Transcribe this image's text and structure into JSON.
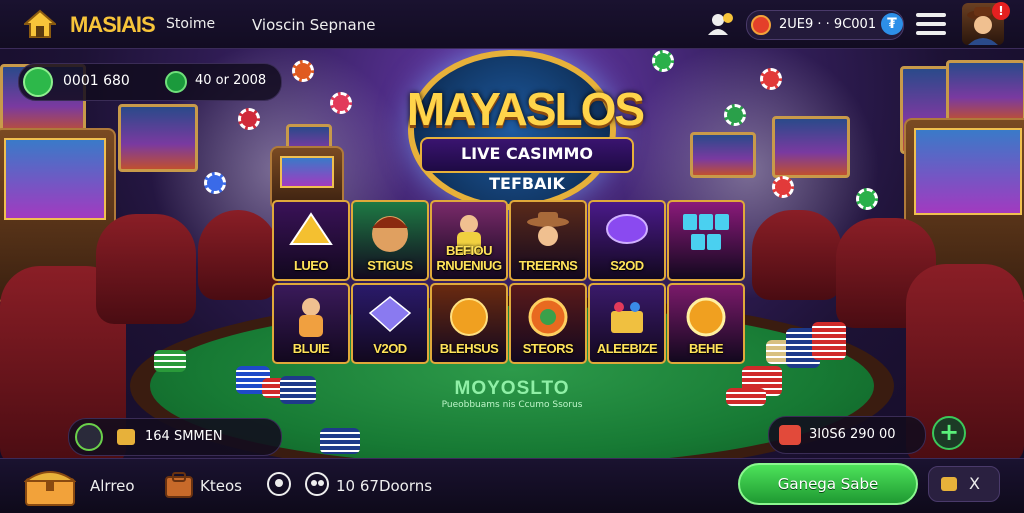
{
  "header": {
    "brand": "MASIAIS",
    "brand_sub": "Stoime",
    "menu_text": "Vioscin Sepnane",
    "currency_value": "2UE9 · · 9C001",
    "currency_plus": "₮",
    "alert_badge": "!"
  },
  "stats": {
    "gems": "0001 680",
    "coins": "40 or 2008"
  },
  "logo": {
    "title": "MAYASLOS",
    "subtitle": "LIVE CASIMMO TEFBAIK"
  },
  "games": [
    {
      "label": "LUEO",
      "bg": "#3a1258",
      "art": "triangle",
      "art_color": "#f4c030"
    },
    {
      "label": "STIGUS",
      "bg": "#1e7a44",
      "art": "face",
      "art_color": "#e0a060"
    },
    {
      "label": "BEFIOU RNUENIUG",
      "bg": "#7a2a6a",
      "art": "character",
      "art_color": "#f0d040"
    },
    {
      "label": "TREERNS",
      "bg": "#5a2a1a",
      "art": "cowboy",
      "art_color": "#a86a3a"
    },
    {
      "label": "S2OD",
      "bg": "#4a1a8a",
      "art": "gem",
      "art_color": "#8a4af0"
    },
    {
      "label": "",
      "bg": "#8a1a7a",
      "art": "cubes",
      "art_color": "#4ad0f0"
    },
    {
      "label": "BLUIE",
      "bg": "#3a1a5a",
      "art": "character",
      "art_color": "#f0a040"
    },
    {
      "label": "V2OD",
      "bg": "#2a1a6a",
      "art": "crystal",
      "art_color": "#8a7af0"
    },
    {
      "label": "BLEHSUS",
      "bg": "#6a2a10",
      "art": "orb",
      "art_color": "#f0a020"
    },
    {
      "label": "STEORS",
      "bg": "#5a1a1a",
      "art": "coin",
      "art_color": "#e86a20"
    },
    {
      "label": "ALEEBIZE",
      "bg": "#3a1a6a",
      "art": "cake",
      "art_color": "#f0c040"
    },
    {
      "label": "BEHE",
      "bg": "#7a1a6a",
      "art": "medal",
      "art_color": "#f0a020"
    }
  ],
  "table": {
    "title": "MOYOSLTO",
    "subtitle": "Pueobbuams nis Ccumo Ssorus"
  },
  "bottom_left_pill": {
    "text": "164 SMMEN"
  },
  "bottom_right_pill": {
    "text": "3I0S6 290 00",
    "add": "+"
  },
  "bottombar": {
    "nav_1": "Alrreo",
    "nav_2": "Kteos",
    "nav_3": "10 67Doorns",
    "cta": "Ganega Sabe",
    "close": "X"
  },
  "colors": {
    "gold": "#f7c43a",
    "felt": "#177a34",
    "cta_green": "#3bc85a",
    "chair_red": "#8a1e26"
  }
}
